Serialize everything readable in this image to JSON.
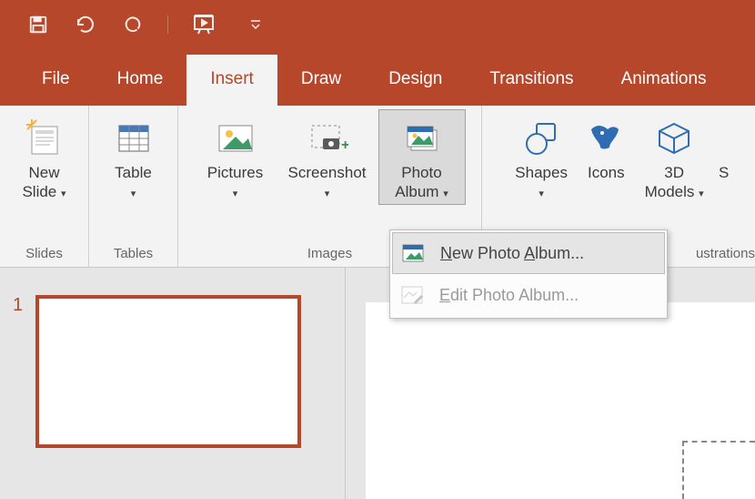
{
  "qat": {
    "save": "save",
    "undo": "undo",
    "redo": "redo",
    "slideshow": "slideshow-from-start",
    "customize": "customize"
  },
  "tabs": {
    "file": "File",
    "home": "Home",
    "insert": "Insert",
    "draw": "Draw",
    "design": "Design",
    "transitions": "Transitions",
    "animations": "Animations"
  },
  "active_tab": "insert",
  "ribbon": {
    "slides": {
      "new_slide_line1": "New",
      "new_slide_line2": "Slide",
      "group_label": "Slides"
    },
    "tables": {
      "table": "Table",
      "group_label": "Tables"
    },
    "images": {
      "pictures": "Pictures",
      "screenshot": "Screenshot",
      "photo_album_line1": "Photo",
      "photo_album_line2": "Album",
      "group_label": "Images"
    },
    "illustrations": {
      "shapes": "Shapes",
      "icons": "Icons",
      "models_line1": "3D",
      "models_line2": "Models",
      "smartart_initial": "S",
      "group_label": "ustrations"
    }
  },
  "photo_album_menu": {
    "new": "New Photo Album...",
    "edit": "Edit Photo Album..."
  },
  "slidelist": {
    "items": [
      {
        "number": "1"
      }
    ]
  }
}
